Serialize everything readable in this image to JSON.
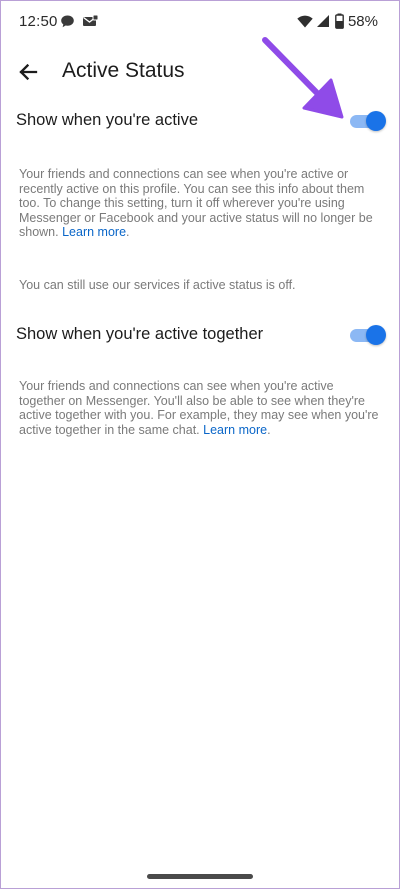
{
  "status_bar": {
    "time": "12:50",
    "battery": "58%",
    "icons": [
      "chat-notification-icon",
      "mail-notification-icon",
      "wifi-icon",
      "signal-icon",
      "battery-icon"
    ]
  },
  "app_bar": {
    "title": "Active Status",
    "back_icon": "back-arrow-icon"
  },
  "settings": [
    {
      "label": "Show when you're active",
      "enabled": true,
      "description": "Your friends and connections can see when you're active or recently active on this profile. You can see this info about them too. To change this setting, turn it off wherever you're using Messenger or Facebook and your active status will no longer be shown. ",
      "link": "Learn more",
      "link_suffix": "."
    },
    {
      "label": "Show when you're active together",
      "enabled": true,
      "description": "Your friends and connections can see when you're active together on Messenger. You'll also be able to see when they're active together with you. For example, they may see when you're active together in the same chat. ",
      "link": "Learn more",
      "link_suffix": "."
    }
  ],
  "note": "You can still use our services if active status is off.",
  "colors": {
    "toggle_thumb": "#1a73e8",
    "toggle_track": "#8cb8f4",
    "link": "#0a66c8",
    "annotation_arrow": "#8f4be8"
  }
}
